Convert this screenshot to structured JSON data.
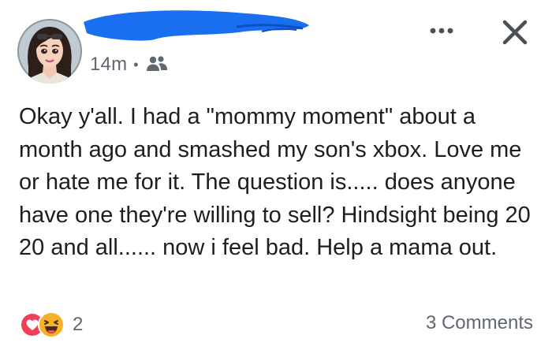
{
  "header": {
    "timestamp": "14m",
    "separator": "•",
    "audience_icon": "friends-icon",
    "more_icon": "more-icon",
    "close_icon": "close-icon"
  },
  "post": {
    "text": "Okay y'all. I had a \"mommy moment\" about a month ago and smashed my son's xbox. Love me or hate me for it. The question is..... does anyone have one they're willing to sell? Hindsight being 20 20 and all...... now i feel bad. Help a mama out."
  },
  "footer": {
    "reaction_icons": [
      "love-icon",
      "haha-icon"
    ],
    "reaction_count": "2",
    "comments_label": "3 Comments"
  },
  "colors": {
    "redaction": "#1a6ef0",
    "love": "#f33e58",
    "haha": "#f7b125",
    "meta_text": "#606770"
  }
}
